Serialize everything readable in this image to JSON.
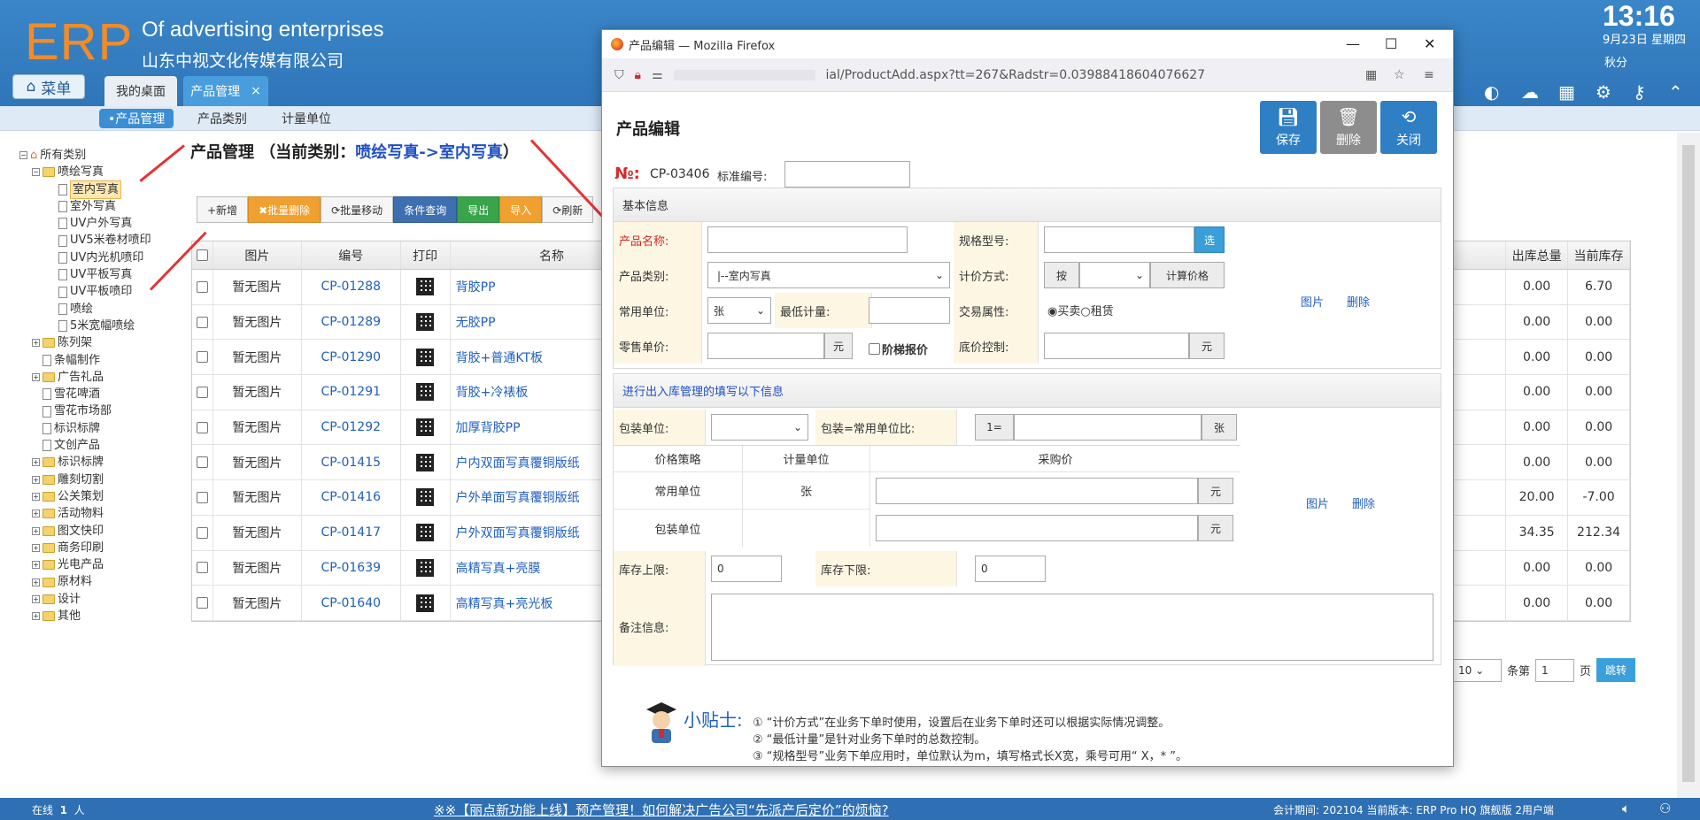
{
  "header": {
    "logo": "ERP",
    "company_en": "Of advertising enterprises",
    "company_cn": "山东中视文化传媒有限公司",
    "menu_label": "菜单",
    "tabs": [
      "我的桌面",
      "产品管理"
    ],
    "time": "13:16",
    "date": "9月23日 星期四",
    "season": "秋分"
  },
  "subnav": [
    "•产品管理",
    "产品类别",
    "计量单位"
  ],
  "tree": {
    "root": "所有类别",
    "nodes": [
      {
        "label": "喷绘写真",
        "level": 1,
        "type": "folder",
        "expanded": true
      },
      {
        "label": "室内写真",
        "level": 2,
        "type": "doc",
        "selected": true
      },
      {
        "label": "室外写真",
        "level": 2,
        "type": "doc"
      },
      {
        "label": "UV户外写真",
        "level": 2,
        "type": "doc"
      },
      {
        "label": "UV5米卷材喷印",
        "level": 2,
        "type": "doc"
      },
      {
        "label": "UV内光机喷印",
        "level": 2,
        "type": "doc"
      },
      {
        "label": "UV平板写真",
        "level": 2,
        "type": "doc"
      },
      {
        "label": "UV平板喷印",
        "level": 2,
        "type": "doc"
      },
      {
        "label": "喷绘",
        "level": 2,
        "type": "doc"
      },
      {
        "label": "5米宽幅喷绘",
        "level": 2,
        "type": "doc"
      },
      {
        "label": "陈列架",
        "level": 1,
        "type": "folder"
      },
      {
        "label": "条幅制作",
        "level": 1,
        "type": "doc"
      },
      {
        "label": "广告礼品",
        "level": 1,
        "type": "folder"
      },
      {
        "label": "雪花啤酒",
        "level": 1,
        "type": "doc"
      },
      {
        "label": "雪花市场部",
        "level": 1,
        "type": "doc"
      },
      {
        "label": "标识标牌",
        "level": 1,
        "type": "doc"
      },
      {
        "label": "文创产品",
        "level": 1,
        "type": "doc"
      },
      {
        "label": "标识标牌",
        "level": 1,
        "type": "folder"
      },
      {
        "label": "雕刻切割",
        "level": 1,
        "type": "folder"
      },
      {
        "label": "公关策划",
        "level": 1,
        "type": "folder"
      },
      {
        "label": "活动物料",
        "level": 1,
        "type": "folder"
      },
      {
        "label": "图文快印",
        "level": 1,
        "type": "folder"
      },
      {
        "label": "商务印刷",
        "level": 1,
        "type": "folder"
      },
      {
        "label": "光电产品",
        "level": 1,
        "type": "folder"
      },
      {
        "label": "原材料",
        "level": 1,
        "type": "folder"
      },
      {
        "label": "设计",
        "level": 1,
        "type": "folder"
      },
      {
        "label": "其他",
        "level": 1,
        "type": "folder"
      }
    ]
  },
  "main": {
    "title_prefix": "产品管理 （当前类别：",
    "title_category": "喷绘写真->室内写真",
    "title_suffix": "）",
    "toolbar": [
      "+新增",
      "✖批量删除",
      "⟳批量移动",
      "条件查询",
      "导出",
      "导入",
      "⟳刷新"
    ],
    "columns": [
      "图片",
      "编号",
      "打印",
      "名称",
      "出库总量",
      "当前库存"
    ],
    "rows": [
      {
        "img": "暂无图片",
        "code": "CP-01288",
        "name": "背胶PP",
        "out": "0.00",
        "stock": "6.70"
      },
      {
        "img": "暂无图片",
        "code": "CP-01289",
        "name": "无胶PP",
        "out": "0.00",
        "stock": "0.00"
      },
      {
        "img": "暂无图片",
        "code": "CP-01290",
        "name": "背胶+普通KT板",
        "out": "0.00",
        "stock": "0.00"
      },
      {
        "img": "暂无图片",
        "code": "CP-01291",
        "name": "背胶+冷裱板",
        "out": "0.00",
        "stock": "0.00"
      },
      {
        "img": "暂无图片",
        "code": "CP-01292",
        "name": "加厚背胶PP",
        "out": "0.00",
        "stock": "0.00"
      },
      {
        "img": "暂无图片",
        "code": "CP-01415",
        "name": "户内双面写真覆铜版纸",
        "out": "0.00",
        "stock": "0.00"
      },
      {
        "img": "暂无图片",
        "code": "CP-01416",
        "name": "户外单面写真覆铜版纸",
        "out": "20.00",
        "stock": "-7.00"
      },
      {
        "img": "暂无图片",
        "code": "CP-01417",
        "name": "户外双面写真覆铜版纸",
        "out": "34.35",
        "stock": "212.34"
      },
      {
        "img": "暂无图片",
        "code": "CP-01639",
        "name": "高精写真+亮膜",
        "out": "0.00",
        "stock": "0.00"
      },
      {
        "img": "暂无图片",
        "code": "CP-01640",
        "name": "高精写真+亮光板",
        "out": "0.00",
        "stock": "0.00"
      }
    ],
    "pager": {
      "page_size": "10",
      "per_page_label": "条第",
      "page": "1",
      "page_label": "页",
      "jump": "跳转"
    }
  },
  "firefox": {
    "title": "产品编辑 — Mozilla Firefox",
    "url": "ial/ProductAdd.aspx?tt=267&Radstr=0.03988418604076627"
  },
  "dialog": {
    "title": "产品编辑",
    "buttons": {
      "save": "保存",
      "delete": "删除",
      "close": "关闭"
    },
    "no_label": "№:",
    "no_value": "CP-03406",
    "std_label": "标准编号:",
    "basic_section": "基本信息",
    "basic": {
      "name_label": "产品名称:",
      "spec_label": "规格型号:",
      "spec_btn": "选",
      "category_label": "产品类别:",
      "category_value": "|--室内写真",
      "pricing_label": "计价方式:",
      "pricing_prefix": "按",
      "calc_price": "计算价格",
      "unit_label": "常用单位:",
      "unit_value": "张",
      "min_qty_label": "最低计量:",
      "trade_label": "交易属性:",
      "trade_buy": "买卖",
      "trade_rent": "租赁",
      "retail_label": "零售单价:",
      "yuan": "元",
      "tier_label": "阶梯报价",
      "floor_label": "底价控制:",
      "image_link": "图片",
      "delete_link": "删除"
    },
    "inventory_section": "进行出入库管理的填写以下信息",
    "inventory": {
      "pack_unit_label": "包装单位:",
      "ratio_label": "包装=常用单位比:",
      "ratio_prefix": "1=",
      "ratio_suffix": "张",
      "price_strategy": "价格策略",
      "measure_unit": "计量单位",
      "purchase_price": "采购价",
      "common_unit": "常用单位",
      "common_unit_value": "张",
      "pack_unit": "包装单位",
      "yuan": "元",
      "stock_max_label": "库存上限:",
      "stock_max": "0",
      "stock_min_label": "库存下限:",
      "stock_min": "0",
      "remark_label": "备注信息:",
      "image_link": "图片",
      "delete_link": "删除"
    },
    "tips_title": "小贴士:",
    "tips": [
      "① “计价方式”在业务下单时使用，设置后在业务下单时还可以根据实际情况调整。",
      "② “最低计量”是针对业务下单时的总数控制。",
      "③ “规格型号”业务下单应用时，单位默认为m，填写格式长X宽，乘号可用“ X，* ”。"
    ]
  },
  "footer": {
    "online_label": "在线",
    "online_count": "1",
    "online_unit": "人",
    "notice": "※※【丽点新功能上线】预产管理！如何解决广告公司“先派产后定价”的烦恼?",
    "version": "会计期间: 202104 当前版本: ERP Pro HQ 旗舰版 2用户端"
  },
  "colors": {
    "header_blue": "#2f76b9",
    "accent_orange": "#f28c28",
    "link_blue": "#1f5fbf",
    "required_red": "#d42a2a",
    "arrow_red": "#e53333"
  }
}
